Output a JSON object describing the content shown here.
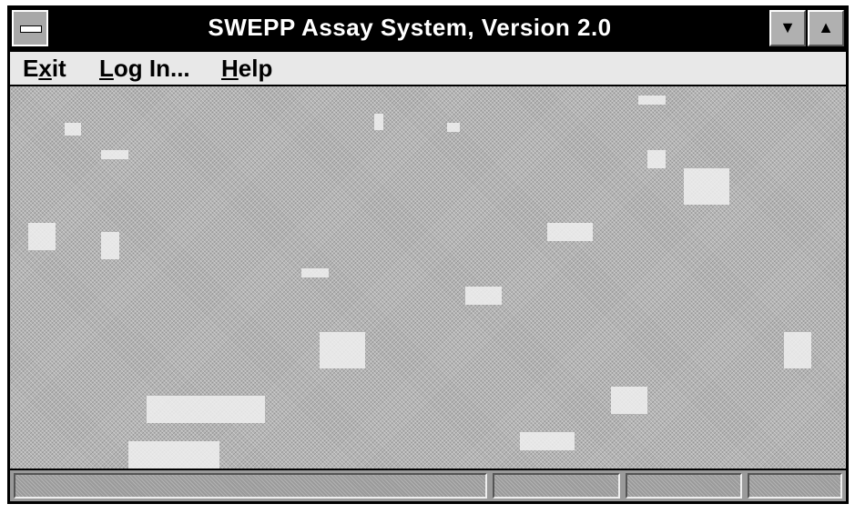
{
  "window": {
    "title": "SWEPP Assay System, Version 2.0"
  },
  "menubar": {
    "exit_label": "Exit",
    "login_label": "Log In...",
    "help_label": "Help"
  },
  "statusbar": {
    "message": "",
    "pane2": "",
    "pane3": "",
    "pane4": ""
  },
  "icons": {
    "system_menu": "system-menu-icon",
    "minimize": "minimize-icon",
    "maximize": "maximize-icon"
  }
}
